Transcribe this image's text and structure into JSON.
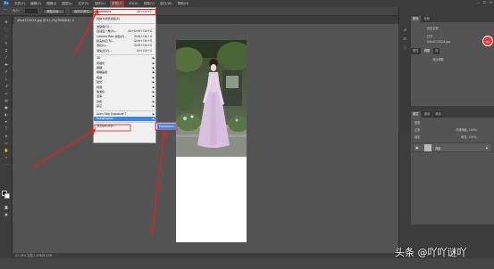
{
  "menubar": {
    "logo": "Ps",
    "items": [
      "文件(F)",
      "编辑(E)",
      "图像(I)",
      "图层(L)",
      "文字(Y)",
      "选择(S)",
      "滤镜(T)",
      "3D(D)",
      "视图(V)",
      "窗口(W)",
      "帮助(H)"
    ],
    "active_index": 6,
    "window_controls": [
      "—",
      "☐",
      "✕"
    ]
  },
  "optionsbar": {
    "label": "大小:",
    "buttons": [
      "调整边缘...",
      "选择并遮住..."
    ]
  },
  "document": {
    "tab_label": "d9e4213224.jpg @ 41.2%(RGB/8#) ×",
    "status": "41.19%    文档:1.63M/5.17M"
  },
  "filter_menu": {
    "items": [
      {
        "label": "Portraiture",
        "shortcut": "Alt+Ctrl+F",
        "first": true
      },
      {
        "label": "转换为智能滤镜(S)",
        "sep_before": true
      },
      {
        "label": "滤镜库(G)...",
        "sep_before": true
      },
      {
        "label": "自适应广角(A)...",
        "shortcut": "Alt+Shift+Ctrl+A"
      },
      {
        "label": "Camera Raw 滤镜(C)...",
        "shortcut": "Shift+Ctrl+A"
      },
      {
        "label": "镜头校正(R)...",
        "shortcut": "Shift+Ctrl+R"
      },
      {
        "label": "液化(L)...",
        "shortcut": "Shift+Ctrl+X"
      },
      {
        "label": "消失点(V)...",
        "shortcut": "Alt+Ctrl+V"
      },
      {
        "label": "3D",
        "submenu": true,
        "sep_before": true
      },
      {
        "label": "风格化",
        "submenu": true
      },
      {
        "label": "模糊",
        "submenu": true
      },
      {
        "label": "模糊画廊",
        "submenu": true
      },
      {
        "label": "扭曲",
        "submenu": true
      },
      {
        "label": "锐化",
        "submenu": true
      },
      {
        "label": "视频",
        "submenu": true
      },
      {
        "label": "像素化",
        "submenu": true
      },
      {
        "label": "渲染",
        "submenu": true
      },
      {
        "label": "杂色",
        "submenu": true
      },
      {
        "label": "其它",
        "submenu": true
      },
      {
        "label": "Alien Skin Exposure 7",
        "submenu": true,
        "sep_before": true
      },
      {
        "label": "Imagenomic",
        "submenu": true,
        "highlight": true
      },
      {
        "label": "浏览联机滤镜...",
        "sep_before": true
      }
    ],
    "submenu_item": "Portraiture..."
  },
  "panels": {
    "top_tabs": [
      "颜色",
      "色板"
    ],
    "history_title": "历史记录",
    "history_items": [
      "打开",
      "d9e4213224.jpg"
    ],
    "adjust_tabs": [
      "属性",
      "调整",
      "库"
    ],
    "adjust_text": "添加调整",
    "layer_tabs": [
      "图层",
      "通道",
      "路径"
    ],
    "layer_kind": "类型",
    "layer_blend": "正常",
    "layer_opacity": "不透明度: 100%",
    "layer_lock": "锁定:",
    "layer_fill": "填充: 100%",
    "layer_name": "背景",
    "badge": "PS"
  },
  "watermark": "头条 @吖吖谜吖",
  "colors": {
    "chrome": "#3c3c3c",
    "canvas": "#535353",
    "highlight": "#3a86f0",
    "annotation": "#e02020"
  }
}
